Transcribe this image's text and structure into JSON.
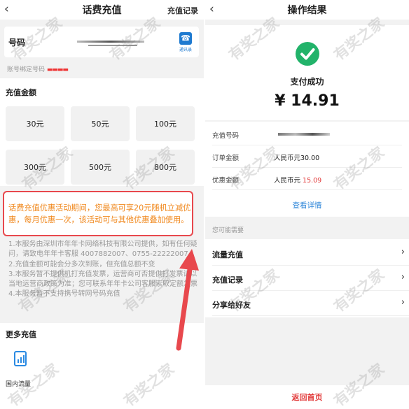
{
  "left": {
    "nav": {
      "back_icon": "back-chevron-icon",
      "title": "话费充值",
      "right_link": "充值记录"
    },
    "phone": {
      "label": "号码",
      "contacts_label": "通讯录",
      "contacts_icon": "contacts-icon"
    },
    "bound_text": "账号绑定号码",
    "bound_masked": "▬▬▬▬",
    "amount_title": "充值金额",
    "amounts": [
      "30元",
      "50元",
      "100元",
      "300元",
      "500元",
      "800元"
    ],
    "promo": "话费充值优惠活动期间，您最高可享20元随机立减优惠，每月优惠一次，该活动可与其他优惠叠加使用。",
    "notes": [
      "1.本服务由深圳市年年卡网络科技有限公司提供，如有任何疑问，请致电年年卡客服 4007882007、0755-22222007",
      "2.充值金额可能会分多次到账，但充值总额不变",
      "3.本服务暂不提供机打充值发票，运营商可否提供打发票请以当地运营商政策为准；您可联系年年卡公司客服索取定额发票",
      "4.本服务暂不支持携号转网号码充值"
    ],
    "more_title": "更多充值",
    "more_item": {
      "label": "国内流量",
      "icon": "mobile-data-icon"
    },
    "accent": "#e8484d",
    "promo_color": "#f0881d"
  },
  "right": {
    "nav": {
      "back_icon": "back-chevron-icon",
      "title": "操作结果"
    },
    "status_icon": "check-circle-icon",
    "status": "支付成功",
    "amount": "¥ 14.91",
    "details": [
      {
        "key": "充值号码",
        "value": ""
      },
      {
        "key": "订单金额",
        "value": "人民币元30.00"
      },
      {
        "key": "优惠金额",
        "value_prefix": "人民币元 ",
        "value_highlight": "15.09"
      }
    ],
    "view_details": "查看详情",
    "may_need": "您可能需要",
    "links": [
      "流量充值",
      "充值记录",
      "分享给好友"
    ],
    "home_button": "返回首页",
    "link_color": "#2b84d8",
    "success_color": "#22b36a"
  },
  "watermark": "有奖之家"
}
